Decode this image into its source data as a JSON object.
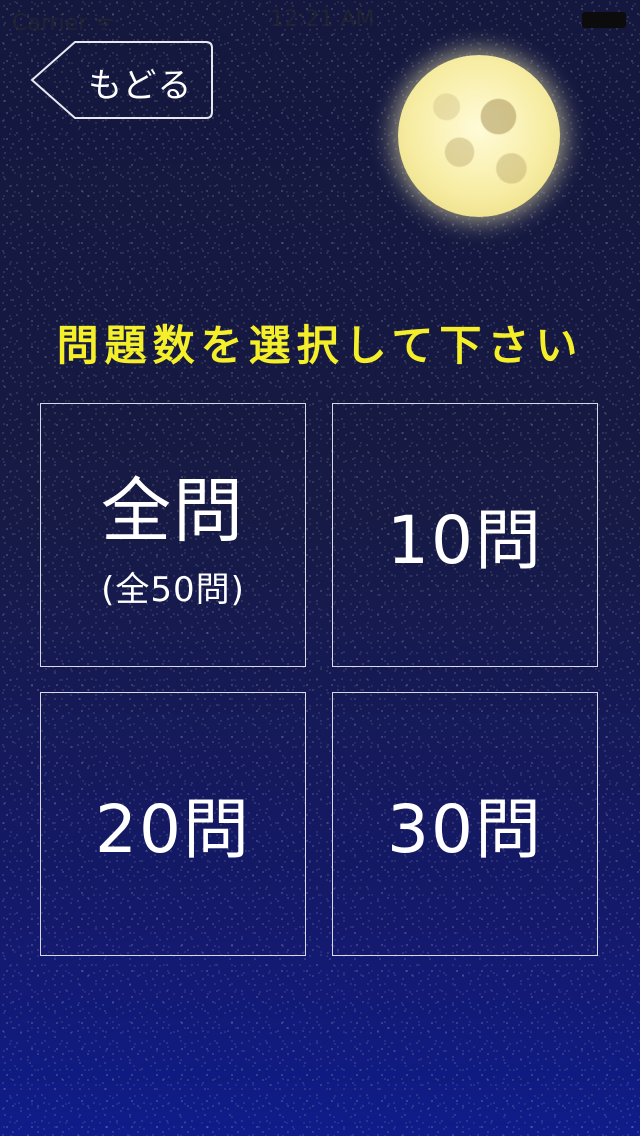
{
  "status_bar": {
    "carrier": "Carrier ᯤ",
    "time": "12:21 AM"
  },
  "back_button": {
    "label": "もどる"
  },
  "title": "問題数を選択して下さい",
  "options": [
    {
      "label": "全問",
      "sub": "(全50問)"
    },
    {
      "label": "10問"
    },
    {
      "label": "20問"
    },
    {
      "label": "30問"
    }
  ],
  "colors": {
    "title": "#f4ef28",
    "background_top": "#14183e",
    "background_bottom": "#0f1c8a",
    "tile_border": "#d8d8e8",
    "moon": "#f7eda4"
  },
  "icons": [
    "back-arrow-icon",
    "moon-image",
    "battery-icon"
  ]
}
